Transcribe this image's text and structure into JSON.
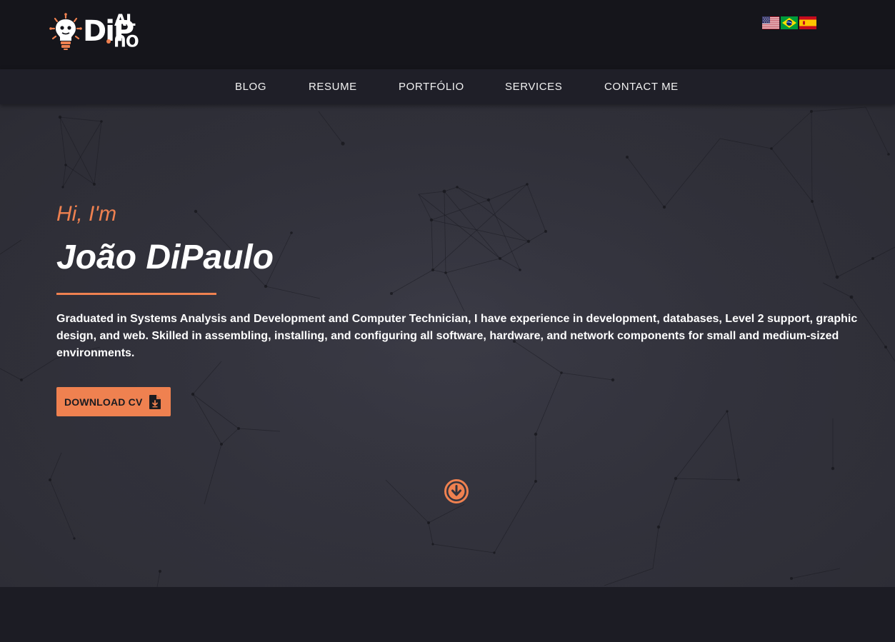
{
  "brand": {
    "logo_name": "DiPaulo logo",
    "accent_color": "#ef8150"
  },
  "languages": [
    {
      "code": "en",
      "icon": "us-flag-icon"
    },
    {
      "code": "pt",
      "icon": "brazil-flag-icon"
    },
    {
      "code": "es",
      "icon": "spain-flag-icon"
    }
  ],
  "nav": {
    "items": [
      "BLOG",
      "RESUME",
      "PORTFÓLIO",
      "SERVICES",
      "CONTACT ME"
    ]
  },
  "hero": {
    "greeting": "Hi, I'm",
    "name": "João DiPaulo",
    "bio": "Graduated in Systems Analysis and Development and Computer Technician, I have experience in development, databases, Level 2 support, graphic design, and web. Skilled in assembling, installing, and configuring all software, hardware, and network components for small and medium-sized environments.",
    "cta_label": "DOWNLOAD CV",
    "cta_icon": "file-download-icon",
    "scroll_icon": "arrow-down-circle-icon"
  },
  "colors": {
    "topbar": "#15151b",
    "navbar": "#1f1f28",
    "hero_bg": "#33333d",
    "accent": "#ef8150"
  }
}
